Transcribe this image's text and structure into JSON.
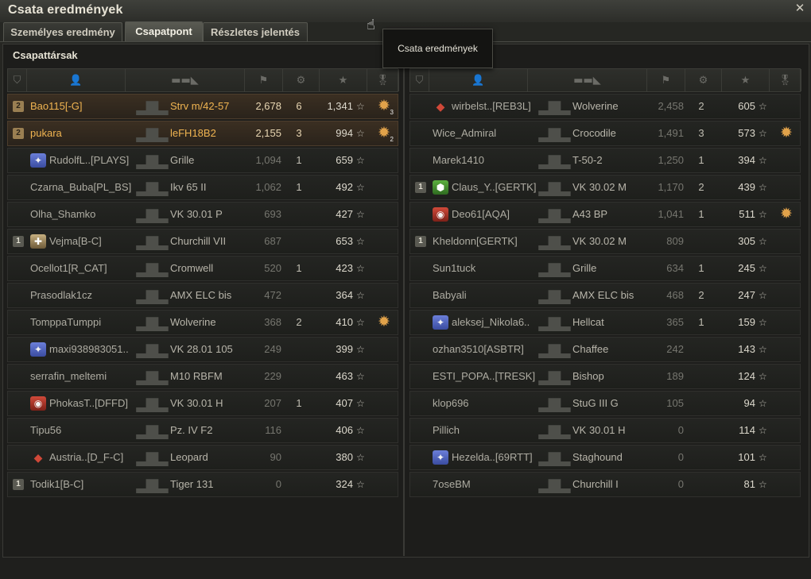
{
  "window": {
    "title": "Csata eredmények",
    "close_icon": "close-icon"
  },
  "tabs": [
    {
      "label": "Személyes eredmény",
      "active": false
    },
    {
      "label": "Csapatpont",
      "active": true
    },
    {
      "label": "Részletes jelentés",
      "active": false
    }
  ],
  "tooltip": {
    "text": "Csata eredmények"
  },
  "section_title": "Csapattársak",
  "columns": [
    "squad-icon",
    "player-icon",
    "tank-icon",
    "xp-icon",
    "kills-icon",
    "damage-star-icon",
    "medal-icon"
  ],
  "left_team": [
    {
      "badge": "2",
      "clan": "",
      "name": "Bao115[-G]",
      "vehicle": "Strv m/42-57",
      "xp": "2,678",
      "kills": "6",
      "damage": "1,341",
      "medal": "3",
      "highlight": true
    },
    {
      "badge": "2",
      "clan": "",
      "name": "pukara",
      "vehicle": "leFH18B2",
      "xp": "2,155",
      "kills": "3",
      "damage": "994",
      "medal": "2",
      "highlight": true
    },
    {
      "badge": "",
      "clan": "blue",
      "name": "RudolfL..[PLAYS]",
      "vehicle": "Grille",
      "xp": "1,094",
      "kills": "1",
      "damage": "659",
      "medal": ""
    },
    {
      "badge": "",
      "clan": "",
      "name": "Czarna_Buba[PL_BS]",
      "vehicle": "Ikv 65 II",
      "xp": "1,062",
      "kills": "1",
      "damage": "492",
      "medal": ""
    },
    {
      "badge": "",
      "clan": "",
      "name": "Olha_Shamko",
      "vehicle": "VK 30.01 P",
      "xp": "693",
      "kills": "",
      "damage": "427",
      "medal": ""
    },
    {
      "badge": "1",
      "clan": "gold",
      "name": "Vejma[B-C]",
      "vehicle": "Churchill VII",
      "xp": "687",
      "kills": "",
      "damage": "653",
      "medal": ""
    },
    {
      "badge": "",
      "clan": "",
      "name": "Ocellot1[R_CAT]",
      "vehicle": "Cromwell",
      "xp": "520",
      "kills": "1",
      "damage": "423",
      "medal": ""
    },
    {
      "badge": "",
      "clan": "",
      "name": "Prasodlak1cz",
      "vehicle": "AMX ELC bis",
      "xp": "472",
      "kills": "",
      "damage": "364",
      "medal": ""
    },
    {
      "badge": "",
      "clan": "",
      "name": "TomppaTumppi",
      "vehicle": "Wolverine",
      "xp": "368",
      "kills": "2",
      "damage": "410",
      "medal": "1"
    },
    {
      "badge": "",
      "clan": "blue",
      "name": "maxi938983051..",
      "vehicle": "VK 28.01 105",
      "xp": "249",
      "kills": "",
      "damage": "399",
      "medal": ""
    },
    {
      "badge": "",
      "clan": "",
      "name": "serrafin_meltemi",
      "vehicle": "M10 RBFM",
      "xp": "229",
      "kills": "",
      "damage": "463",
      "medal": ""
    },
    {
      "badge": "",
      "clan": "red",
      "name": "PhokasT..[DFFD]",
      "vehicle": "VK 30.01 H",
      "xp": "207",
      "kills": "1",
      "damage": "407",
      "medal": ""
    },
    {
      "badge": "",
      "clan": "",
      "name": "Tipu56",
      "vehicle": "Pz. IV F2",
      "xp": "116",
      "kills": "",
      "damage": "406",
      "medal": ""
    },
    {
      "badge": "",
      "clan": "diamond",
      "name": "Austria..[D_F-C]",
      "vehicle": "Leopard",
      "xp": "90",
      "kills": "",
      "damage": "380",
      "medal": ""
    },
    {
      "badge": "1",
      "clan": "",
      "name": "Todik1[B-C]",
      "vehicle": "Tiger 131",
      "xp": "0",
      "kills": "",
      "damage": "324",
      "medal": ""
    }
  ],
  "right_team": [
    {
      "badge": "",
      "clan": "diamond",
      "name": "wirbelst..[REB3L]",
      "vehicle": "Wolverine",
      "xp": "2,458",
      "kills": "2",
      "damage": "605",
      "medal": ""
    },
    {
      "badge": "",
      "clan": "",
      "name": "Wice_Admiral",
      "vehicle": "Crocodile",
      "xp": "1,491",
      "kills": "3",
      "damage": "573",
      "medal": "1"
    },
    {
      "badge": "",
      "clan": "",
      "name": "Marek1410",
      "vehicle": "T-50-2",
      "xp": "1,250",
      "kills": "1",
      "damage": "394",
      "medal": ""
    },
    {
      "badge": "1",
      "clan": "green",
      "name": "Claus_Y..[GERTK]",
      "vehicle": "VK 30.02 M",
      "xp": "1,170",
      "kills": "2",
      "damage": "439",
      "medal": ""
    },
    {
      "badge": "",
      "clan": "red",
      "name": "Deo61[AQA]",
      "vehicle": "A43 BP",
      "xp": "1,041",
      "kills": "1",
      "damage": "511",
      "medal": "1"
    },
    {
      "badge": "1",
      "clan": "",
      "name": "Kheldonn[GERTK]",
      "vehicle": "VK 30.02 M",
      "xp": "809",
      "kills": "",
      "damage": "305",
      "medal": ""
    },
    {
      "badge": "",
      "clan": "",
      "name": "Sun1tuck",
      "vehicle": "Grille",
      "xp": "634",
      "kills": "1",
      "damage": "245",
      "medal": ""
    },
    {
      "badge": "",
      "clan": "",
      "name": "Babyali",
      "vehicle": "AMX ELC bis",
      "xp": "468",
      "kills": "2",
      "damage": "247",
      "medal": ""
    },
    {
      "badge": "",
      "clan": "blue",
      "name": "aleksej_Nikola6..",
      "vehicle": "Hellcat",
      "xp": "365",
      "kills": "1",
      "damage": "159",
      "medal": ""
    },
    {
      "badge": "",
      "clan": "",
      "name": "ozhan3510[ASBTR]",
      "vehicle": "Chaffee",
      "xp": "242",
      "kills": "",
      "damage": "143",
      "medal": ""
    },
    {
      "badge": "",
      "clan": "",
      "name": "ESTI_POPA..[TRESK]",
      "vehicle": "Bishop",
      "xp": "189",
      "kills": "",
      "damage": "124",
      "medal": ""
    },
    {
      "badge": "",
      "clan": "",
      "name": "klop696",
      "vehicle": "StuG III G",
      "xp": "105",
      "kills": "",
      "damage": "94",
      "medal": ""
    },
    {
      "badge": "",
      "clan": "",
      "name": "Pillich",
      "vehicle": "VK 30.01 H",
      "xp": "0",
      "kills": "",
      "damage": "114",
      "medal": ""
    },
    {
      "badge": "",
      "clan": "blue",
      "name": "Hezelda..[69RTT]",
      "vehicle": "Staghound",
      "xp": "0",
      "kills": "",
      "damage": "101",
      "medal": ""
    },
    {
      "badge": "",
      "clan": "",
      "name": "7oseBM",
      "vehicle": "Churchill I",
      "xp": "0",
      "kills": "",
      "damage": "81",
      "medal": ""
    }
  ]
}
